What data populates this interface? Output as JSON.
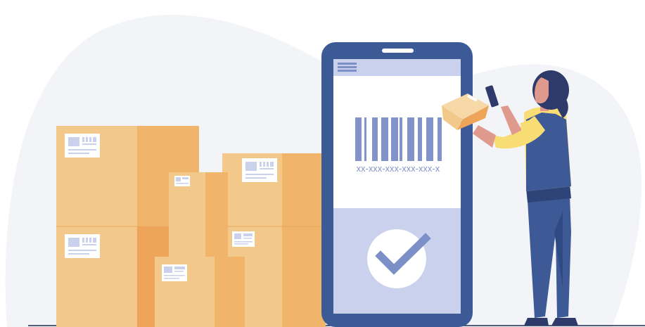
{
  "illustration": {
    "barcode_number": "xx-xxx-xxx-xxx-xxx-x",
    "colors": {
      "background_blob": "#f3f4f8",
      "box_light": "#f2c98a",
      "box_mid": "#f0b46a",
      "box_dark": "#eea55a",
      "phone_frame": "#3b5a96",
      "phone_screen_accent": "#c9d1ec",
      "barcode": "#8193c9",
      "check": "#7d8fc7",
      "person_pants": "#3d5a97",
      "person_vest": "#3d5a97",
      "person_shirt": "#f8dd74",
      "person_skin": "#e09a8d",
      "person_hair": "#2e3a6a"
    }
  }
}
